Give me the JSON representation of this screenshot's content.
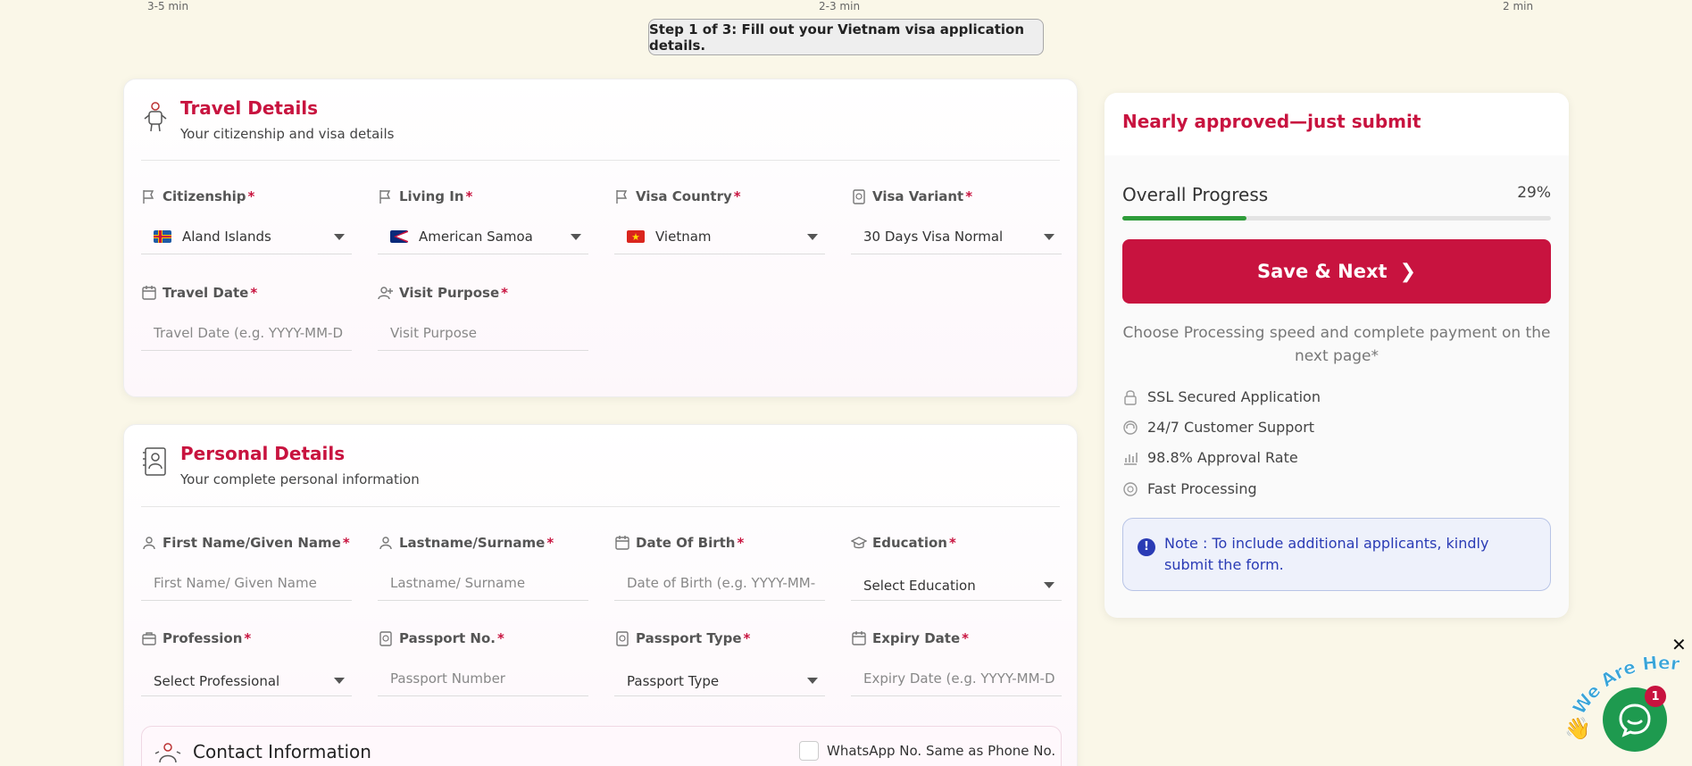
{
  "timeline": {
    "left": "3-5 min",
    "center": "2-3 min",
    "right": "2 min"
  },
  "step_text": "Step 1 of 3: Fill out your Vietnam visa application details.",
  "travel": {
    "title": "Travel Details",
    "subtitle": "Your citizenship and visa details",
    "fields": {
      "citizenship": {
        "label": "Citizenship",
        "value": "Aland Islands"
      },
      "living_in": {
        "label": "Living In",
        "value": "American Samoa"
      },
      "visa_country": {
        "label": "Visa Country",
        "value": "Vietnam"
      },
      "visa_variant": {
        "label": "Visa Variant",
        "value": "30 Days Visa Normal"
      },
      "travel_date": {
        "label": "Travel Date",
        "placeholder": "Travel Date (e.g. YYYY-MM-D"
      },
      "visit_purpose": {
        "label": "Visit Purpose",
        "placeholder": "Visit Purpose"
      }
    }
  },
  "personal": {
    "title": "Personal Details",
    "subtitle": "Your complete personal information",
    "fields": {
      "first_name": {
        "label": "First Name/Given Name",
        "placeholder": "First Name/ Given Name"
      },
      "last_name": {
        "label": "Lastname/Surname",
        "placeholder": "Lastname/ Surname"
      },
      "dob": {
        "label": "Date Of Birth",
        "placeholder": "Date of Birth (e.g. YYYY-MM-"
      },
      "education": {
        "label": "Education",
        "value": "Select Education"
      },
      "profession": {
        "label": "Profession",
        "value": "Select Professional"
      },
      "passport_no": {
        "label": "Passport No.",
        "placeholder": "Passport Number"
      },
      "passport_type": {
        "label": "Passport Type",
        "value": "Passport Type"
      },
      "expiry": {
        "label": "Expiry Date",
        "placeholder": "Expiry Date (e.g. YYYY-MM-D"
      }
    }
  },
  "contact": {
    "title": "Contact Information",
    "whatsapp_label": "WhatsApp No. Same as Phone No."
  },
  "required_mark": "*",
  "sidebar": {
    "title": "Nearly approved—just submit",
    "progress_label": "Overall Progress",
    "progress_text": "29%",
    "progress_value": 0.29,
    "save_label": "Save & Next",
    "save_chevron": "❯",
    "choose_text": "Choose Processing speed and complete payment on the next page*",
    "features": [
      "SSL Secured Application",
      "24/7 Customer Support",
      "98.8% Approval Rate",
      "Fast Processing"
    ],
    "note": "Note : To include additional applicants, kindly submit the form.",
    "note_icon": "!"
  },
  "chat": {
    "badge": "1",
    "close": "✕",
    "tagline": "We Are Here!"
  },
  "colors": {
    "accent": "#c8133f",
    "progress": "#2e9c3a",
    "note_text": "#2a3bb5",
    "chat": "#1e9a4f",
    "background": "#faf7e8"
  }
}
